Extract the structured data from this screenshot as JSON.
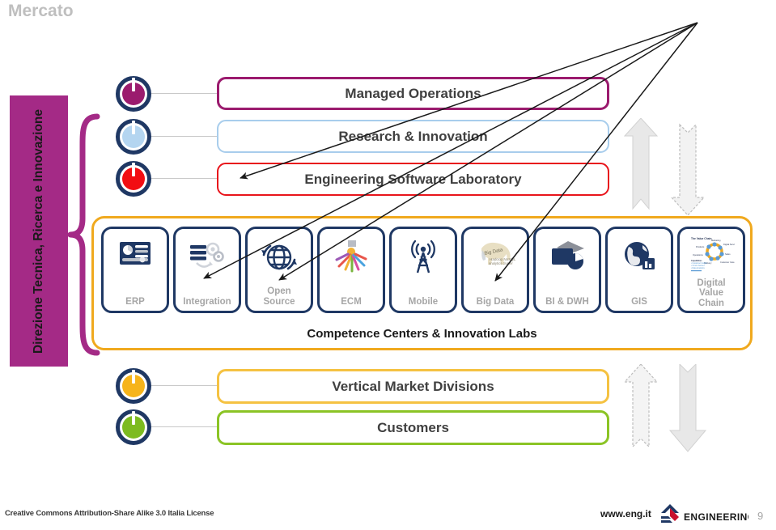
{
  "slide": {
    "title": "Mercato",
    "page_number": "9"
  },
  "department": {
    "label": "Direzione Tecnica, Ricerca e Innovazione",
    "color": "#a42a86"
  },
  "layers": [
    {
      "id": "managed-operations",
      "label": "Managed Operations",
      "border_color": "#9b1b6e",
      "dot_color": "#9b1b6e"
    },
    {
      "id": "research-innovation",
      "label": "Research & Innovation",
      "border_color": "#a8cdec",
      "dot_color": "#b4d5f0"
    },
    {
      "id": "engineering-software-laboratory",
      "label": "Engineering Software Laboratory",
      "border_color": "#e8141b",
      "dot_color": "#f20d12"
    }
  ],
  "competence": {
    "caption": "Competence Centers & Innovation Labs",
    "container_color": "#f0a91e",
    "card_color": "#1f3864",
    "cards": [
      {
        "label": "ERP",
        "icon": "erp-dashboard-icon"
      },
      {
        "label": "Integration",
        "icon": "integration-gears-icon"
      },
      {
        "label": "Open\nSource",
        "label_line1": "Open",
        "label_line2": "Source",
        "icon": "globe-sync-icon"
      },
      {
        "label": "ECM",
        "icon": "ecm-tagcloud-icon"
      },
      {
        "label": "Mobile",
        "icon": "mobile-antenna-icon"
      },
      {
        "label": "Big Data",
        "icon": "big-data-elephant-icon"
      },
      {
        "label": "BI & DWH",
        "icon": "bi-dwh-chart-icon"
      },
      {
        "label": "GIS",
        "icon": "gis-globe-icon"
      },
      {
        "label": "Digital\nValue\nChain",
        "label_line1": "Digital",
        "label_line2": "Value",
        "label_line3": "Chain",
        "icon": "digital-value-chain-diagram-icon"
      }
    ]
  },
  "bottom_layers": [
    {
      "id": "vertical-market-divisions",
      "label": "Vertical Market Divisions",
      "border_color": "#f5c242",
      "dot_color": "#f6b41b"
    },
    {
      "id": "customers",
      "label": "Customers",
      "border_color": "#8bc425",
      "dot_color": "#7dbb20"
    }
  ],
  "market_arrows": {
    "top_up": "up-arrow-solid",
    "top_down": "down-arrow-dashed",
    "bottom_up": "up-arrow-dashed",
    "bottom_down": "down-arrow-solid",
    "color": "#e4e4e4"
  },
  "footer": {
    "license": "Creative Commons Attribution-Share Alike 3.0 Italia License",
    "url": "www.eng.it",
    "logo_text": "ENGINEERING"
  }
}
